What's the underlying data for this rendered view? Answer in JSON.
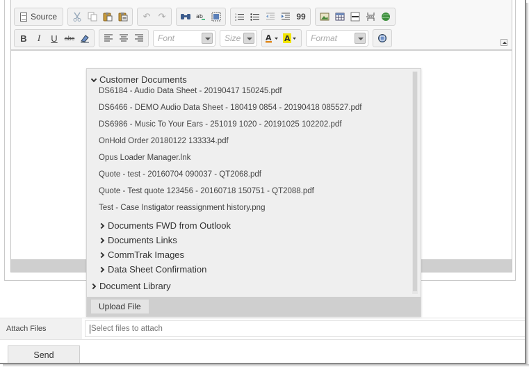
{
  "toolbar": {
    "source_label": "Source",
    "font_placeholder": "Font",
    "size_placeholder": "Size",
    "format_placeholder": "Format",
    "bold": "B",
    "italic": "I",
    "underline": "U",
    "strike": "abc",
    "blockquote": "99"
  },
  "file_browser": {
    "root_folder": "Customer Documents",
    "files": [
      "DS6184 - Audio Data Sheet - 20190417 150245.pdf",
      "DS6466 - DEMO Audio Data Sheet - 180419 0854 - 20190418 085527.pdf",
      "DS6986 - Music To Your Ears - 251019 1020 - 20191025 102202.pdf",
      "OnHold Order 20180122 133334.pdf",
      "Opus Loader Manager.lnk",
      "Quote - test - 20160704 090037 - QT2068.pdf",
      "Quote - Test quote 123456 - 20160718 150751 - QT2088.pdf",
      "Test - Case Instigator reassignment history.png"
    ],
    "subfolders": [
      "Documents FWD from Outlook",
      "Documents Links",
      "CommTrak Images",
      "Data Sheet Confirmation"
    ],
    "other_root": "Document Library",
    "upload_label": "Upload File"
  },
  "attach": {
    "label": "Attach Files",
    "placeholder": "Select files to attach"
  },
  "send_label": "Send",
  "colors": {
    "toolbar_bg": "#f8f8f8",
    "dropdown_bg": "#efefef",
    "footer_bg": "#cfcfcf",
    "text_highlight": "#f2e600"
  }
}
